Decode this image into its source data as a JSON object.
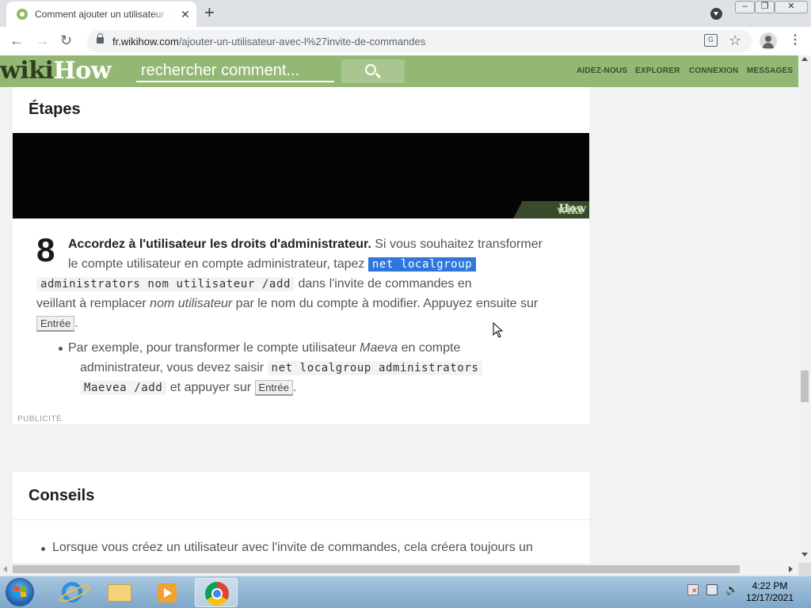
{
  "browser": {
    "tab_title": "Comment ajouter un utilisateur avec l'invite de commandes",
    "url_domain": "fr.wikihow.com",
    "url_path": "/ajouter-un-utilisateur-avec-l%27invite-de-commandes"
  },
  "site": {
    "logo_dark": "wiki",
    "logo_light": "How",
    "search_placeholder": "rechercher comment...",
    "nav": [
      "AIDEZ-NOUS",
      "EXPLORER",
      "CONNEXION",
      "MESSAGES"
    ]
  },
  "steps": {
    "heading": "Étapes",
    "video_watermark_dark": "wiki",
    "video_watermark_light": "How",
    "step_number": "8",
    "bold_text": "Accordez à l'utilisateur les droits d'administrateur.",
    "text_a": " Si vous souhaitez transformer",
    "text_b": "le compte utilisateur en compte administrateur, tapez ",
    "code_selected": "net localgroup",
    "code_rest": "administrators nom utilisateur /add",
    "text_c": " dans l'invite de commandes en",
    "text_d": "veillant à remplacer ",
    "text_d_italic": "nom utilisateur",
    "text_e": " par le nom du compte à modifier. Appuyez ensuite sur",
    "key_label": "Entrée",
    "text_f": ".",
    "bullet_a": "Par exemple, pour transformer le compte utilisateur ",
    "bullet_italic": "Maeva",
    "bullet_b": " en compte",
    "bullet_c": "administrateur, vous devez saisir ",
    "bullet_code_a": "net localgroup administrators",
    "bullet_code_b": "Maevea /add",
    "bullet_d": " et appuyer sur ",
    "bullet_key": "Entrée",
    "bullet_end": ".",
    "ad_label": "PUBLICITÉ"
  },
  "tips": {
    "heading": "Conseils",
    "item": "Lorsque vous créez un utilisateur avec l'invite de commandes, cela créera toujours un"
  },
  "taskbar": {
    "time": "4:22 PM",
    "date": "12/17/2021"
  },
  "colors": {
    "wikihow_green": "#93b874",
    "selection_blue": "#2f77dc"
  }
}
